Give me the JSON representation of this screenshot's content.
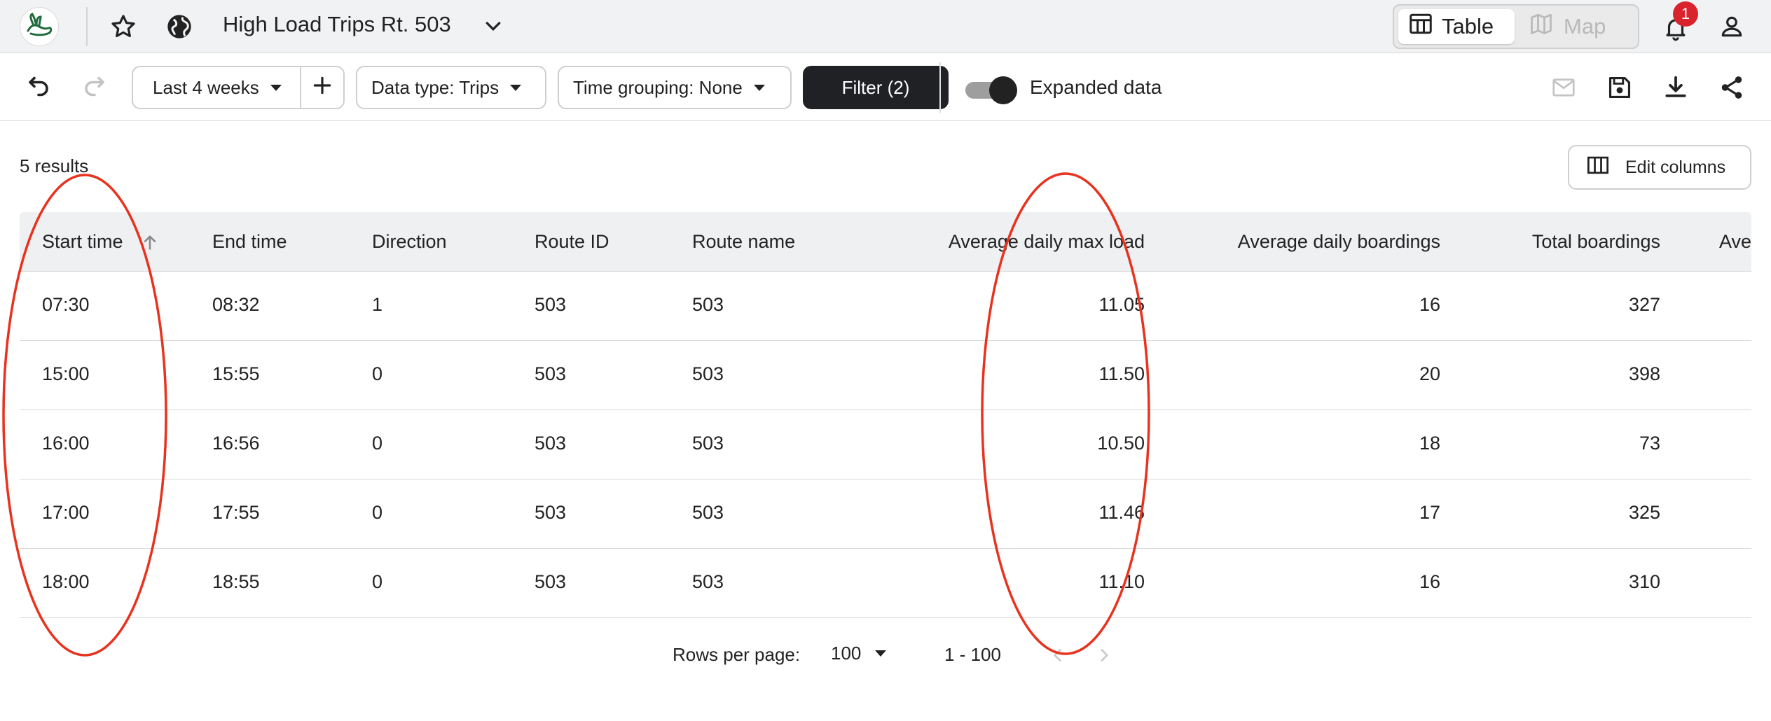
{
  "header": {
    "title": "High Load Trips Rt. 503",
    "view_table_label": "Table",
    "view_map_label": "Map",
    "notification_count": "1",
    "icons": {
      "logo": "rabbit-logo-icon",
      "favorite": "star-icon",
      "public": "globe-icon",
      "title_menu": "chevron-down-icon",
      "table_view": "table-icon",
      "map_view": "map-icon",
      "notifications": "bell-icon",
      "account": "person-icon"
    }
  },
  "toolbar": {
    "date_range": "Last 4 weeks",
    "data_type": "Data type: Trips",
    "time_grouping": "Time grouping: None",
    "filter_label": "Filter (2)",
    "expanded_label": "Expanded data",
    "expanded_on": true,
    "icons": [
      "undo-icon",
      "redo-icon",
      "add-icon",
      "mail-icon",
      "save-icon",
      "download-icon",
      "share-icon"
    ]
  },
  "results": {
    "count_label": "5 results",
    "edit_columns_label": "Edit columns"
  },
  "table": {
    "columns": [
      "Start time",
      "End time",
      "Direction",
      "Route ID",
      "Route name",
      "Average daily max load",
      "Average daily boardings",
      "Total boardings",
      "Ave"
    ],
    "sorted_column": "Start time",
    "sort_direction": "ascending",
    "rows": [
      [
        "07:30",
        "08:32",
        "1",
        "503",
        "503",
        "11.05",
        "16",
        "327"
      ],
      [
        "15:00",
        "15:55",
        "0",
        "503",
        "503",
        "11.50",
        "20",
        "398"
      ],
      [
        "16:00",
        "16:56",
        "0",
        "503",
        "503",
        "10.50",
        "18",
        "73"
      ],
      [
        "17:00",
        "17:55",
        "0",
        "503",
        "503",
        "11.46",
        "17",
        "325"
      ],
      [
        "18:00",
        "18:55",
        "0",
        "503",
        "503",
        "11.10",
        "16",
        "310"
      ]
    ]
  },
  "pagination": {
    "rows_per_page_label": "Rows per page:",
    "rows_per_page_value": "100",
    "range_label": "1 - 100"
  },
  "annotations": {
    "color": "#e8321e",
    "highlighted_columns": [
      "Start time",
      "Average daily max load"
    ]
  }
}
